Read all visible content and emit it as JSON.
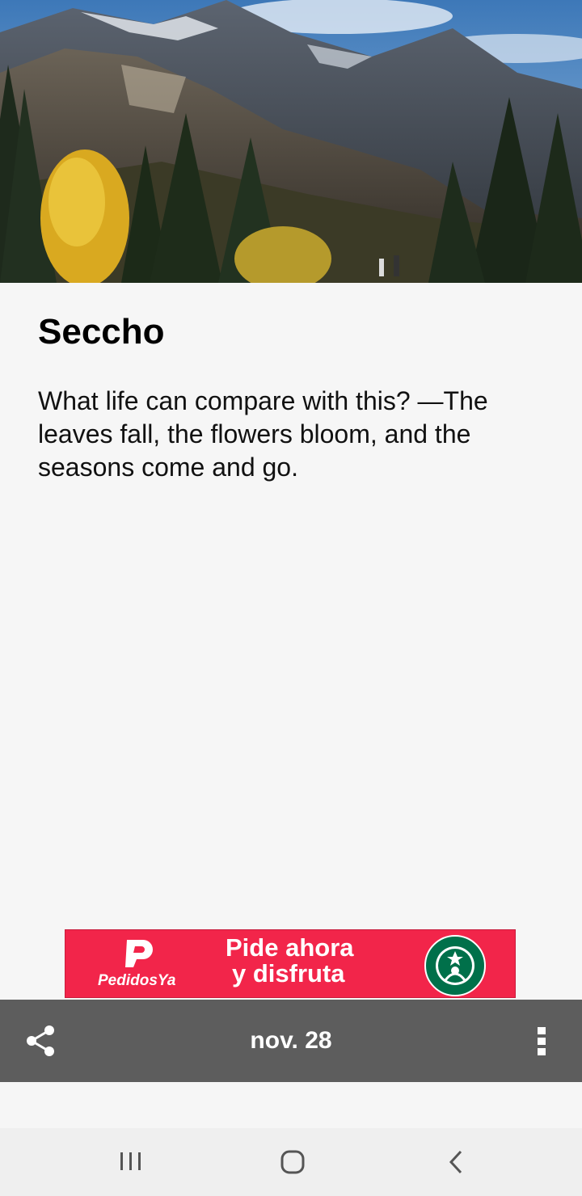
{
  "article": {
    "title": "Seccho",
    "quote": "What life can compare with this? —The leaves fall, the flowers bloom, and the seasons come and go."
  },
  "ad": {
    "brand": "PedidosYa",
    "line1": "Pide ahora",
    "line2": "y disfruta",
    "background_color": "#f2254a"
  },
  "toolbar": {
    "date": "nov. 28",
    "background_color": "#5d5d5d",
    "share_icon": "share-icon",
    "menu_icon": "more-vert-icon"
  },
  "navbar": {
    "recents_icon": "recents-icon",
    "home_icon": "home-icon",
    "back_icon": "back-icon"
  }
}
